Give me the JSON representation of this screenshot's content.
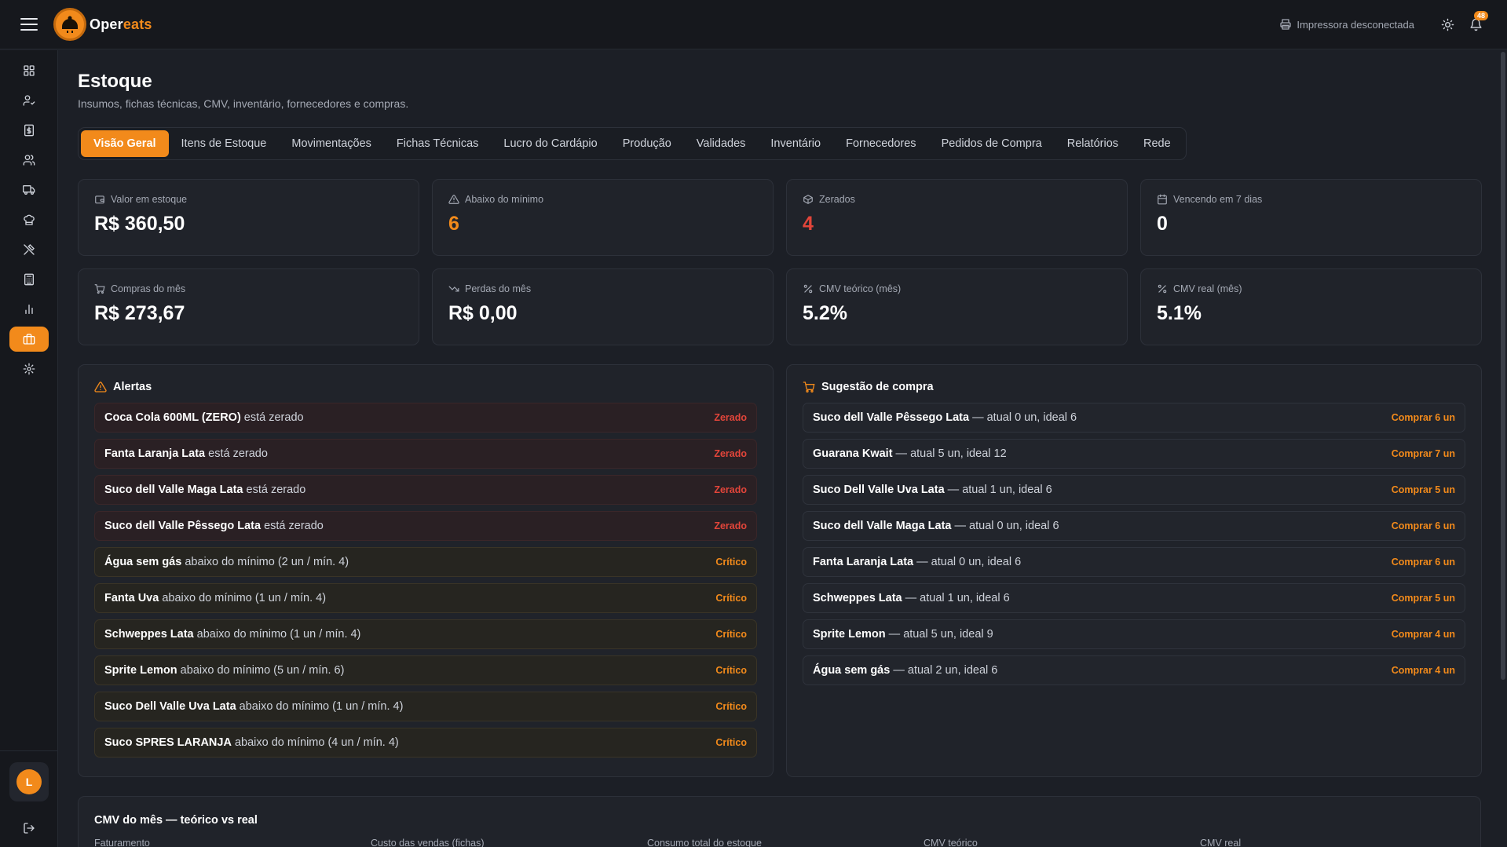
{
  "brand": {
    "name_part1": "Oper",
    "name_part2": "eats"
  },
  "topbar": {
    "printer_status": "Impressora desconectada",
    "notifications_count": "48"
  },
  "sidebar": {
    "items": [
      {
        "icon": "dashboard-icon"
      },
      {
        "icon": "user-check-icon"
      },
      {
        "icon": "receipt-icon"
      },
      {
        "icon": "users-icon"
      },
      {
        "icon": "truck-icon"
      },
      {
        "icon": "chef-hat-icon"
      },
      {
        "icon": "utensils-icon"
      },
      {
        "icon": "calculator-icon"
      },
      {
        "icon": "bar-chart-icon"
      },
      {
        "icon": "package-icon",
        "active": true
      },
      {
        "icon": "settings-icon"
      }
    ],
    "user_initial": "L"
  },
  "page": {
    "title": "Estoque",
    "subtitle": "Insumos, fichas técnicas, CMV, inventário, fornecedores e compras."
  },
  "tabs": [
    {
      "label": "Visão Geral",
      "active": true
    },
    {
      "label": "Itens de Estoque"
    },
    {
      "label": "Movimentações"
    },
    {
      "label": "Fichas Técnicas"
    },
    {
      "label": "Lucro do Cardápio"
    },
    {
      "label": "Produção"
    },
    {
      "label": "Validades"
    },
    {
      "label": "Inventário"
    },
    {
      "label": "Fornecedores"
    },
    {
      "label": "Pedidos de Compra"
    },
    {
      "label": "Relatórios"
    },
    {
      "label": "Rede"
    }
  ],
  "kpis": [
    {
      "label": "Valor em estoque",
      "value": "R$ 360,50",
      "icon": "wallet-icon",
      "tone": "default"
    },
    {
      "label": "Abaixo do mínimo",
      "value": "6",
      "icon": "warning-icon",
      "tone": "orange"
    },
    {
      "label": "Zerados",
      "value": "4",
      "icon": "box-icon",
      "tone": "red"
    },
    {
      "label": "Vencendo em 7 dias",
      "value": "0",
      "icon": "calendar-icon",
      "tone": "default"
    },
    {
      "label": "Compras do mês",
      "value": "R$ 273,67",
      "icon": "cart-icon",
      "tone": "default"
    },
    {
      "label": "Perdas do mês",
      "value": "R$ 0,00",
      "icon": "trending-down-icon",
      "tone": "default"
    },
    {
      "label": "CMV teórico (mês)",
      "value": "5.2%",
      "icon": "percent-icon",
      "tone": "default"
    },
    {
      "label": "CMV real (mês)",
      "value": "5.1%",
      "icon": "percent-icon",
      "tone": "default"
    }
  ],
  "alerts": {
    "title": "Alertas",
    "items": [
      {
        "name": "Coca Cola 600ML (ZERO)",
        "text": " está zerado",
        "tag": "Zerado",
        "type": "zerado"
      },
      {
        "name": "Fanta Laranja Lata",
        "text": " está zerado",
        "tag": "Zerado",
        "type": "zerado"
      },
      {
        "name": "Suco dell Valle Maga Lata",
        "text": " está zerado",
        "tag": "Zerado",
        "type": "zerado"
      },
      {
        "name": "Suco dell Valle Pêssego Lata",
        "text": " está zerado",
        "tag": "Zerado",
        "type": "zerado"
      },
      {
        "name": "Água sem gás",
        "text": " abaixo do mínimo (2 un / mín. 4)",
        "tag": "Crítico",
        "type": "critico"
      },
      {
        "name": "Fanta Uva",
        "text": " abaixo do mínimo (1 un / mín. 4)",
        "tag": "Crítico",
        "type": "critico"
      },
      {
        "name": "Schweppes Lata",
        "text": " abaixo do mínimo (1 un / mín. 4)",
        "tag": "Crítico",
        "type": "critico"
      },
      {
        "name": "Sprite Lemon",
        "text": " abaixo do mínimo (5 un / mín. 6)",
        "tag": "Crítico",
        "type": "critico"
      },
      {
        "name": "Suco Dell Valle Uva Lata",
        "text": " abaixo do mínimo (1 un / mín. 4)",
        "tag": "Crítico",
        "type": "critico"
      },
      {
        "name": "Suco SPRES LARANJA",
        "text": " abaixo do mínimo (4 un / mín. 4)",
        "tag": "Crítico",
        "type": "critico"
      }
    ]
  },
  "suggestions": {
    "title": "Sugestão de compra",
    "items": [
      {
        "name": "Suco dell Valle Pêssego Lata",
        "text": " — atual 0 un, ideal 6",
        "action": "Comprar 6 un"
      },
      {
        "name": "Guarana Kwait",
        "text": " — atual 5 un, ideal 12",
        "action": "Comprar 7 un"
      },
      {
        "name": "Suco Dell Valle Uva Lata",
        "text": " — atual 1 un, ideal 6",
        "action": "Comprar 5 un"
      },
      {
        "name": "Suco dell Valle Maga Lata",
        "text": " — atual 0 un, ideal 6",
        "action": "Comprar 6 un"
      },
      {
        "name": "Fanta Laranja Lata",
        "text": " — atual 0 un, ideal 6",
        "action": "Comprar 6 un"
      },
      {
        "name": "Schweppes Lata",
        "text": " — atual 1 un, ideal 6",
        "action": "Comprar 5 un"
      },
      {
        "name": "Sprite Lemon",
        "text": " — atual 5 un, ideal 9",
        "action": "Comprar 4 un"
      },
      {
        "name": "Água sem gás",
        "text": " — atual 2 un, ideal 6",
        "action": "Comprar 4 un"
      }
    ]
  },
  "cmv": {
    "title": "CMV do mês — teórico vs real",
    "columns": [
      "Faturamento",
      "Custo das vendas (fichas)",
      "Consumo total do estoque",
      "CMV teórico",
      "CMV real"
    ]
  },
  "colors": {
    "accent": "#f28a1b",
    "danger": "#e2453a",
    "background": "#1c1f26",
    "surface": "#20232a"
  }
}
